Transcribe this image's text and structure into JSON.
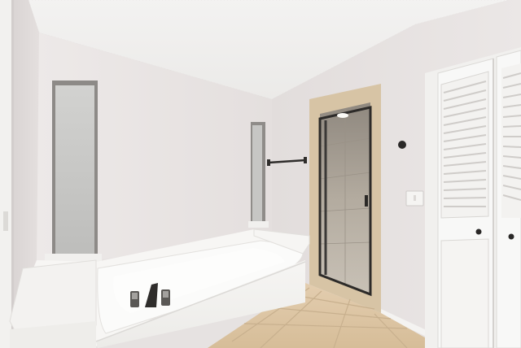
{
  "scene": {
    "subject": "bathroom-interior",
    "colors": {
      "ceiling": "#f0efee",
      "wall_left": "#e2dddc",
      "wall_back": "#e9e5e4",
      "wall_right": "#e4dfde",
      "tub": "#f4f3f1",
      "tile": "#dcc6a6",
      "grout": "#c9b190",
      "door_frame": "#d8c6a9",
      "shower_glass": "#aca59b",
      "window_glass": "#c9c9c7",
      "fixture_dark": "#3c3a38",
      "louver_door": "#f7f7f6"
    },
    "icons": [
      "window-icon",
      "towel-bar-icon",
      "shower-door-icon",
      "tub-faucet-icon",
      "light-switch-icon",
      "closet-door-icon"
    ]
  }
}
